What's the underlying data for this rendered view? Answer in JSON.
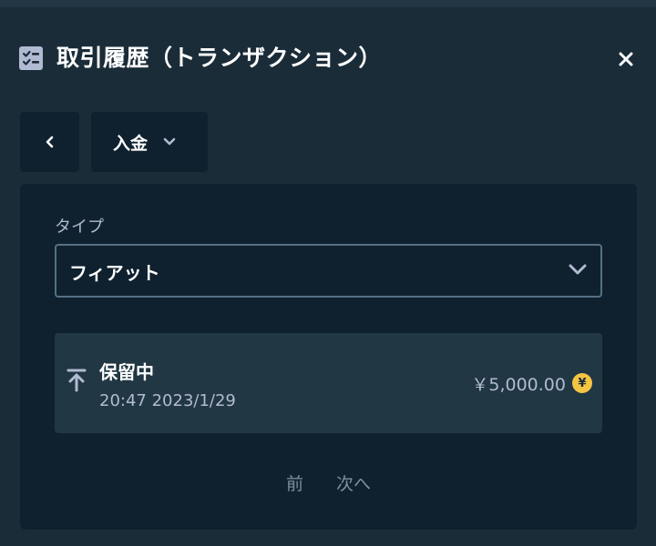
{
  "header": {
    "title": "取引履歴（トランザクション）",
    "icon": "checklist-icon",
    "close_icon": "×"
  },
  "nav": {
    "back_icon": "chevron-left-icon",
    "filter_label": "入金"
  },
  "panel": {
    "type_label": "タイプ",
    "type_value": "フィアット"
  },
  "transaction": {
    "status": "保留中",
    "timestamp": "20:47 2023/1/29",
    "amount": "￥5,000.00",
    "currency_symbol": "¥",
    "currency_color": "#f5c542"
  },
  "pager": {
    "prev_label": "前",
    "next_label": "次へ"
  },
  "colors": {
    "background": "#1a2c38",
    "card": "#0f212e",
    "row": "#213743",
    "muted_text": "#b1bad3"
  }
}
